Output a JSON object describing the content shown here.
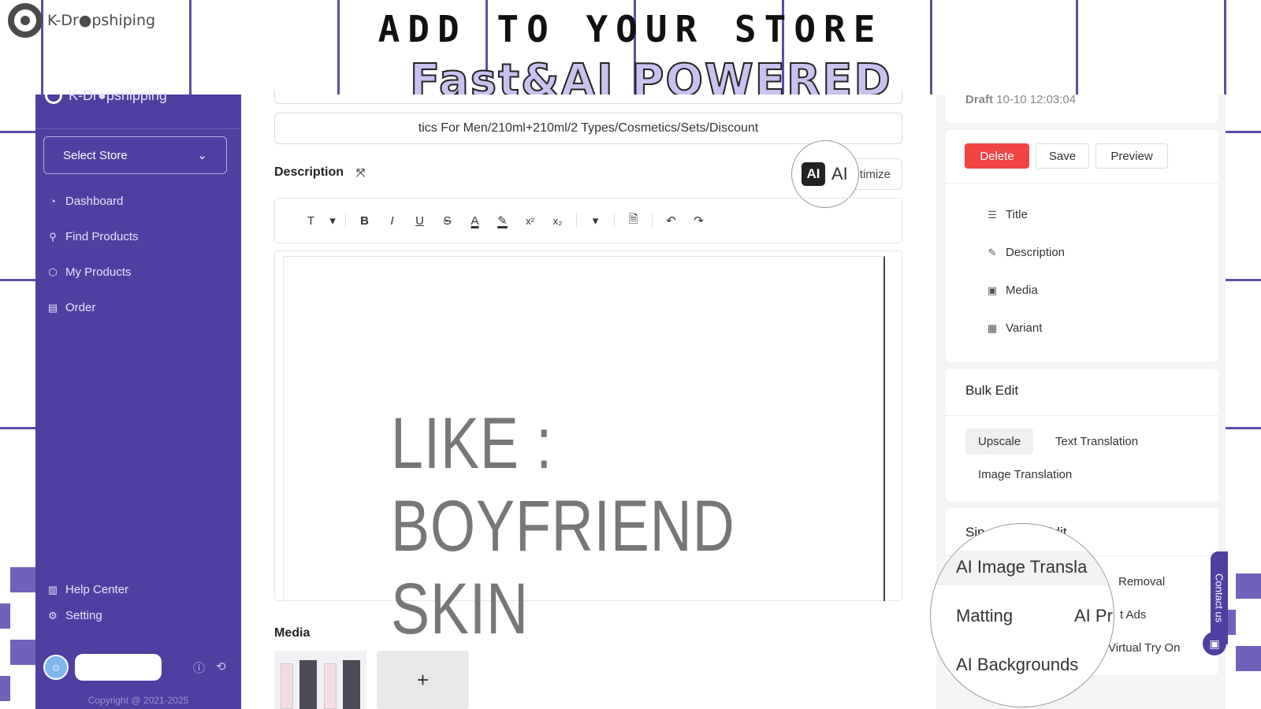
{
  "promo": {
    "brand": "K-Dr●pshiping",
    "headline": "ADD TO YOUR STORE",
    "tagline": "Fast&AI POWERED"
  },
  "sidebar": {
    "brand": "K-Dr●pshipping",
    "select_store": "Select Store",
    "items": [
      {
        "label": "Dashboard",
        "icon": "dashboard-icon"
      },
      {
        "label": "Find Products",
        "icon": "search-icon"
      },
      {
        "label": "My Products",
        "icon": "cube-icon"
      },
      {
        "label": "Order",
        "icon": "document-icon"
      }
    ],
    "bottom_items": [
      {
        "label": "Help Center",
        "icon": "book-icon"
      },
      {
        "label": "Setting",
        "icon": "gear-icon"
      }
    ],
    "copyright": "Copyright @ 2021-2025"
  },
  "editor": {
    "title_value": "tics For Men/210ml+210ml/2 Types/Cosmetics/Sets/Discount",
    "description_label": "Description",
    "optimize_label": "ptimize",
    "ai_badge": "AI",
    "ai_text": "AI",
    "toolbar": [
      "T",
      "B",
      "I",
      "U",
      "S",
      "A",
      "✎",
      "x²",
      "x₂"
    ],
    "content_line1": "LIKE :",
    "content_line2": "BOYFRIEND SKIN",
    "media_label": "Media",
    "add_media": "+"
  },
  "right": {
    "draft_label": "Draft",
    "draft_time": "10-10 12:03:04",
    "delete": "Delete",
    "save": "Save",
    "preview": "Preview",
    "nav": [
      {
        "label": "Title",
        "icon": "list-icon"
      },
      {
        "label": "Description",
        "icon": "pencil-icon"
      },
      {
        "label": "Media",
        "icon": "image-icon"
      },
      {
        "label": "Variant",
        "icon": "grid-icon"
      }
    ],
    "bulk_title": "Bulk Edit",
    "bulk_chips": [
      "Upscale",
      "Text Translation",
      "Image Translation"
    ],
    "single_title_left": "Sin",
    "single_title_right": "Edit",
    "single_items_right": [
      "Removal",
      "t Ads",
      "Virtual Try On"
    ],
    "magnifier_items": [
      "AI Image Transla",
      "Matting",
      "AI Pr",
      "AI Backgrounds"
    ]
  },
  "contact": "Contact us"
}
